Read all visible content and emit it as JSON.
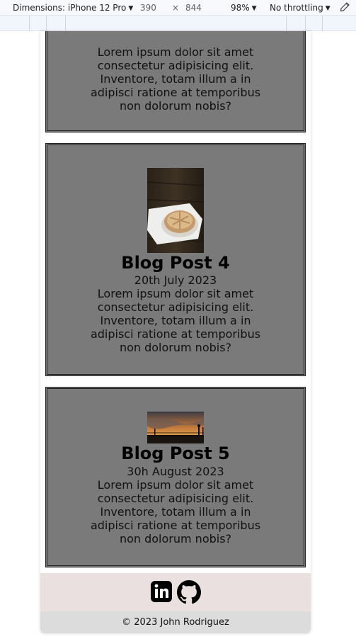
{
  "devtools": {
    "dimensions_label": "Dimensions: iPhone 12 Pro",
    "width": "390",
    "times": "×",
    "height": "844",
    "zoom": "98%",
    "throttling": "No throttling"
  },
  "posts": [
    {
      "title": "",
      "date": "",
      "body": "Lorem ipsum dolor sit amet consectetur adipisicing elit. Inventore, totam illum a in adipisci ratione at temporibus non dolorum nobis?"
    },
    {
      "title": "Blog Post 4",
      "date": "20th July 2023",
      "body": "Lorem ipsum dolor sit amet consectetur adipisicing elit. Inventore, totam illum a in adipisci ratione at temporibus non dolorum nobis?",
      "image": "pastry-photo"
    },
    {
      "title": "Blog Post 5",
      "date": "30h August 2023",
      "body": "Lorem ipsum dolor sit amet consectetur adipisicing elit. Inventore, totam illum a in adipisci ratione at temporibus non dolorum nobis?",
      "image": "sunset-photo"
    }
  ],
  "footer": {
    "icons": [
      "linkedin-icon",
      "github-icon"
    ],
    "copyright": "© 2023 John Rodriguez",
    "icon_bg": "#ebe0e0",
    "copyright_bg": "#dcdcdc"
  },
  "colors": {
    "card_bg": "#7a7a7a",
    "card_border": "#222222"
  }
}
